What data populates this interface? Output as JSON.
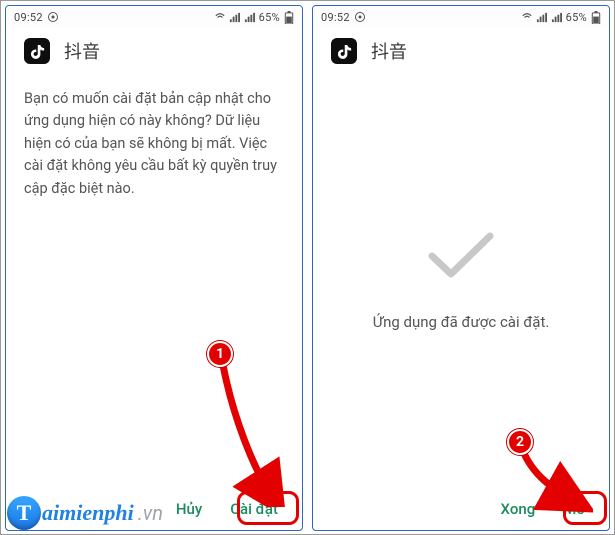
{
  "statusbar": {
    "time": "09:52",
    "battery_pct": "65%"
  },
  "app": {
    "title": "抖音"
  },
  "left": {
    "message": "Bạn có muốn cài đặt bản cập nhật cho ứng dụng hiện có này không? Dữ liệu hiện có của bạn sẽ không bị mất. Việc cài đặt không yêu cầu bất kỳ quyền truy cập đặc biệt nào.",
    "cancel_label": "Hủy",
    "install_label": "Cài đặt"
  },
  "right": {
    "message": "Ứng dụng đã được cài đặt.",
    "done_label": "Xong",
    "open_label": "Mở"
  },
  "annotations": {
    "callout1": "1",
    "callout2": "2"
  },
  "watermark": {
    "glyph": "T",
    "text": "aimienphi",
    "suffix": ".vn"
  }
}
